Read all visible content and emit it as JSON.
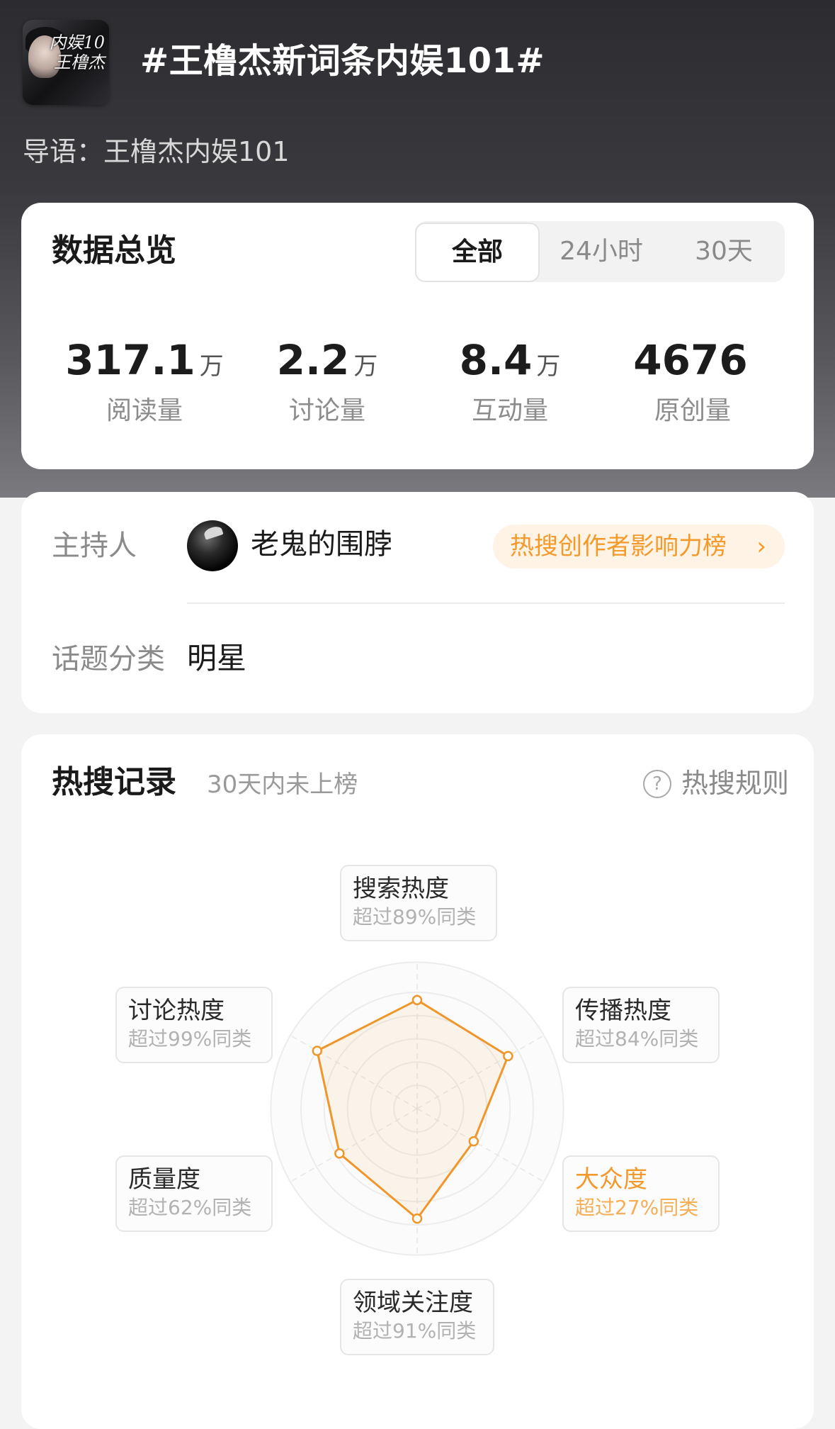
{
  "header": {
    "cover_text": "内娱10\n王橹杰",
    "title": "#王橹杰新词条内娱101#",
    "intro": "导语：王橹杰内娱101"
  },
  "overview": {
    "title": "数据总览",
    "tabs": [
      {
        "label": "全部",
        "active": true
      },
      {
        "label": "24小时",
        "active": false
      },
      {
        "label": "30天",
        "active": false
      }
    ],
    "stats": [
      {
        "value": "317.1",
        "unit": "万",
        "label": "阅读量"
      },
      {
        "value": "2.2",
        "unit": "万",
        "label": "讨论量"
      },
      {
        "value": "8.4",
        "unit": "万",
        "label": "互动量"
      },
      {
        "value": "4676",
        "unit": "",
        "label": "原创量"
      }
    ]
  },
  "info": {
    "host_label": "主持人",
    "host_name": "老鬼的围脖",
    "rank_link": "热搜创作者影响力榜",
    "rank_arrow": "›",
    "category_label": "话题分类",
    "category_value": "明星"
  },
  "hot": {
    "title": "热搜记录",
    "subtitle": "30天内未上榜",
    "rules_icon": "?",
    "rules_label": "热搜规则",
    "accent_color": "#f0962a",
    "dimensions": [
      {
        "name": "搜索热度",
        "sub": "超过89%同类",
        "percent": 89,
        "highlight": false
      },
      {
        "name": "传播热度",
        "sub": "超过84%同类",
        "percent": 84,
        "highlight": false
      },
      {
        "name": "大众度",
        "sub": "超过27%同类",
        "percent": 27,
        "highlight": true
      },
      {
        "name": "领域关注度",
        "sub": "超过91%同类",
        "percent": 91,
        "highlight": false
      },
      {
        "name": "质量度",
        "sub": "超过62%同类",
        "percent": 62,
        "highlight": false
      },
      {
        "name": "讨论热度",
        "sub": "超过99%同类",
        "percent": 99,
        "highlight": false
      }
    ]
  }
}
